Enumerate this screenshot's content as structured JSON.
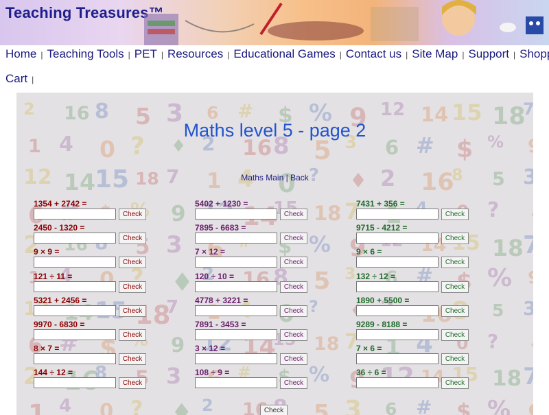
{
  "site": {
    "title": "Teaching Treasures™"
  },
  "nav": {
    "row1": [
      "Home",
      "Teaching Tools",
      "PET",
      "Resources",
      "Educational Games",
      "Contact us",
      "Site Map",
      "Support",
      "Shopping"
    ],
    "row2": [
      "Cart"
    ]
  },
  "page": {
    "heading": "Maths level 5 - page 2",
    "main_link": "Maths Main",
    "back_link": "Back",
    "check_label": "Check"
  },
  "columns": [
    {
      "color": "#8b0000",
      "items": [
        "1354 + 2742 =",
        "2450 - 1320 =",
        "9 × 9 =",
        "121 ÷ 11 =",
        "5321 + 2456 =",
        "9970 - 6830 =",
        "8 × 7 =",
        "144 ÷ 12 ="
      ]
    },
    {
      "color": "#6a1b6a",
      "items": [
        "5402 + 1230 =",
        "7895 - 6683 =",
        "7 × 12 =",
        "120 ÷ 10 =",
        "4778 + 3221  =",
        "7891 - 3453 =",
        "3 × 12 =",
        "108 ÷ 9 ="
      ]
    },
    {
      "color": "#1f6b2a",
      "items": [
        "7431 + 356 =",
        "9715 - 4212 =",
        "9 × 6 =",
        "132 ÷ 12 =",
        "1890 + 5500 =",
        "9289 - 8188 =",
        "7 × 6 =",
        "36 ÷ 6 ="
      ]
    }
  ]
}
